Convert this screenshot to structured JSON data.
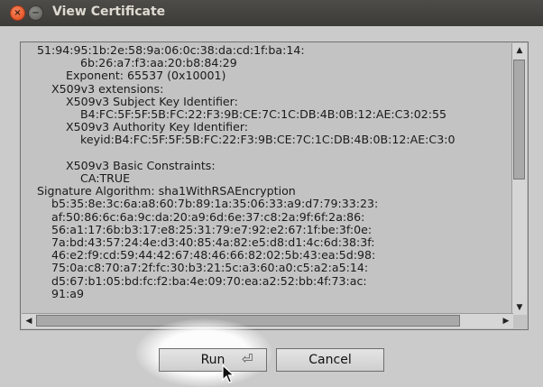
{
  "window": {
    "title": "View Certificate",
    "close_glyph": "×",
    "minimize_glyph": "−"
  },
  "certificate_text": "51:94:95:1b:2e:58:9a:06:0c:38:da:cd:1f:ba:14:\n            6b:26:a7:f3:aa:20:b8:84:29\n        Exponent: 65537 (0x10001)\n    X509v3 extensions:\n        X509v3 Subject Key Identifier:\n            B4:FC:5F:5F:5B:FC:22:F3:9B:CE:7C:1C:DB:4B:0B:12:AE:C3:02:55\n        X509v3 Authority Key Identifier:\n            keyid:B4:FC:5F:5F:5B:FC:22:F3:9B:CE:7C:1C:DB:4B:0B:12:AE:C3:0\n\n        X509v3 Basic Constraints:\n            CA:TRUE\nSignature Algorithm: sha1WithRSAEncryption\n    b5:35:8e:3c:6a:a8:60:7b:89:1a:35:06:33:a9:d7:79:33:23:\n    af:50:86:6c:6a:9c:da:20:a9:6d:6e:37:c8:2a:9f:6f:2a:86:\n    56:a1:17:6b:b3:17:e8:25:31:79:e7:92:e2:67:1f:be:3f:0e:\n    7a:bd:43:57:24:4e:d3:40:85:4a:82:e5:d8:d1:4c:6d:38:3f:\n    46:e2:f9:cd:59:44:42:67:48:46:66:82:02:5b:43:ea:5d:98:\n    75:0a:c8:70:a7:2f:fc:30:b3:21:5c:a3:60:a0:c5:a2:a5:14:\n    d5:67:b1:05:bd:fc:f2:ba:4e:09:70:ea:a2:52:bb:4f:73:ac:\n    91:a9",
  "scrollbar": {
    "up_glyph": "▲",
    "down_glyph": "▼",
    "left_glyph": "◀",
    "right_glyph": "▶"
  },
  "buttons": {
    "run_label": "Run",
    "cancel_label": "Cancel"
  },
  "icons": {
    "enter_glyph": "⏎"
  }
}
